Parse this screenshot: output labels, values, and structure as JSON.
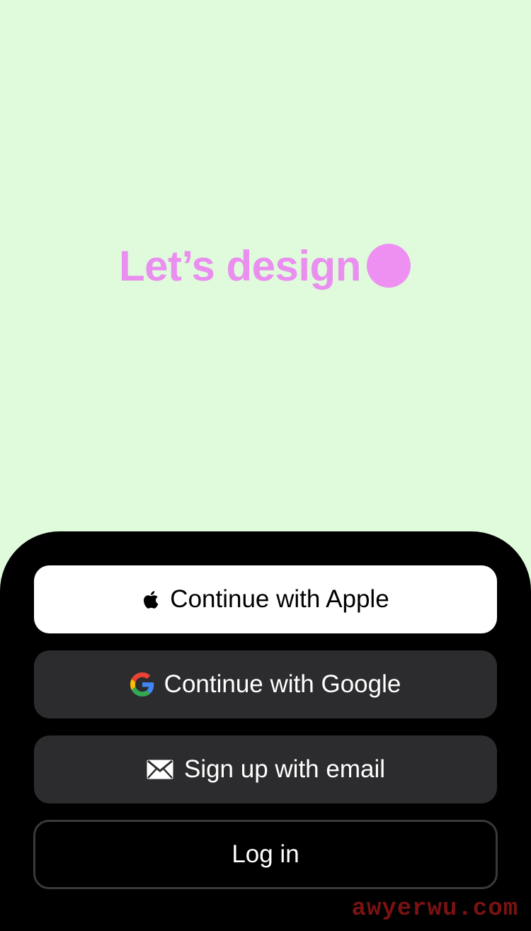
{
  "hero": {
    "tagline": "Let’s design",
    "dot_color": "#ee90f2",
    "background": "#dffbdc"
  },
  "auth": {
    "apple_label": "Continue with Apple",
    "google_label": "Continue with Google",
    "email_label": "Sign up with email",
    "login_label": "Log in",
    "icons": {
      "apple": "apple-logo-icon",
      "google": "google-logo-icon",
      "email": "envelope-icon"
    }
  },
  "watermark": {
    "text": "awyerwu.com"
  },
  "colors": {
    "sheet": "#000000",
    "primary_button": "#ffffff",
    "secondary_button": "#2c2c2e",
    "outline": "#3a3a3c"
  }
}
